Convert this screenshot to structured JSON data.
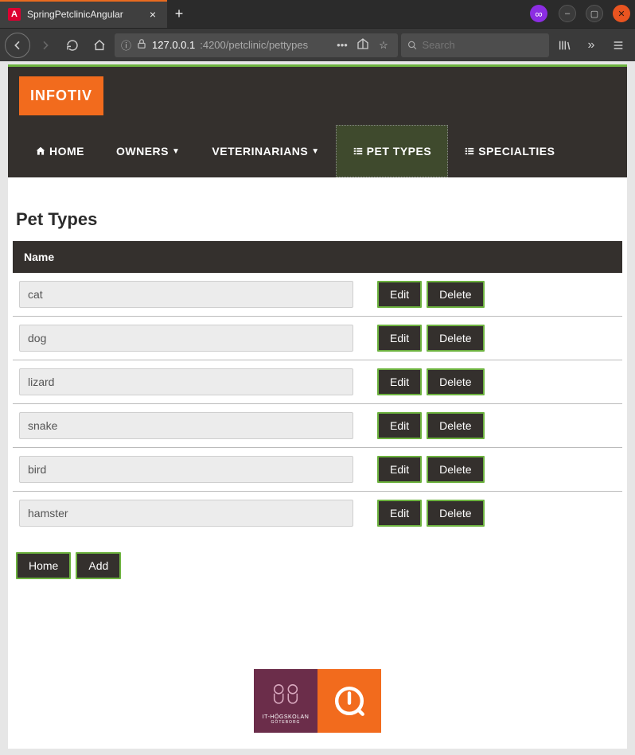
{
  "browser": {
    "tab_title": "SpringPetclinicAngular",
    "url_host": "127.0.0.1",
    "url_port_path": ":4200/petclinic/pettypes",
    "search_placeholder": "Search"
  },
  "logo_text": "INFOTIV",
  "nav": {
    "home": "HOME",
    "owners": "OWNERS",
    "vets": "VETERINARIANS",
    "pettypes": "PET TYPES",
    "specialties": "SPECIALTIES"
  },
  "page_title": "Pet Types",
  "table_header": "Name",
  "rows": [
    {
      "name": "cat"
    },
    {
      "name": "dog"
    },
    {
      "name": "lizard"
    },
    {
      "name": "snake"
    },
    {
      "name": "bird"
    },
    {
      "name": "hamster"
    }
  ],
  "buttons": {
    "edit": "Edit",
    "delete": "Delete",
    "home": "Home",
    "add": "Add"
  },
  "footer": {
    "hs_line1": "IT-HÖGSKOLAN",
    "hs_line2": "GÖTEBORG"
  }
}
